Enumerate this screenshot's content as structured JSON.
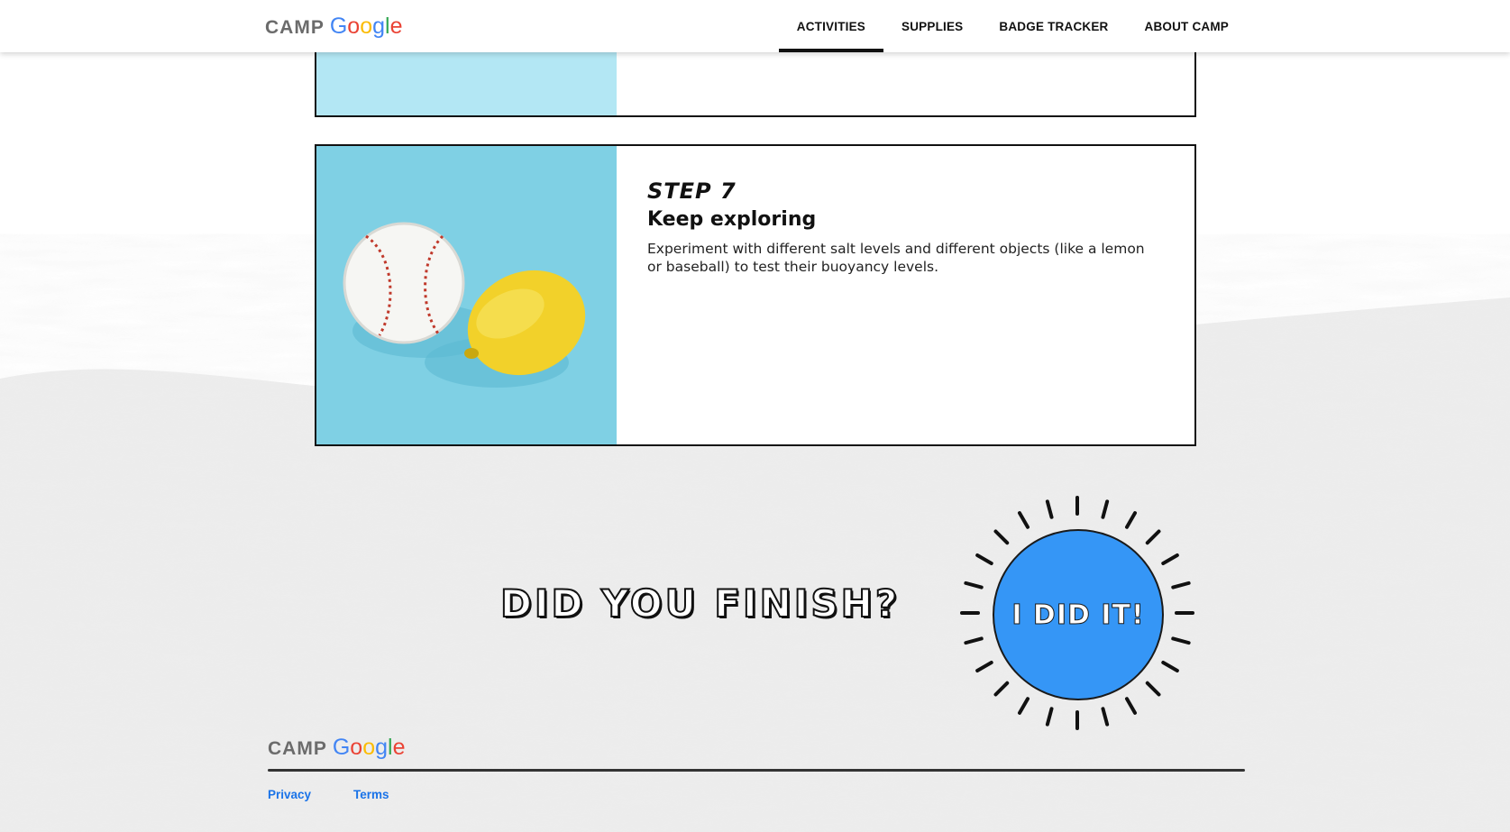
{
  "header": {
    "logo": {
      "camp": "CAMP",
      "google": [
        "G",
        "o",
        "o",
        "g",
        "l",
        "e"
      ]
    },
    "nav": [
      {
        "label": "ACTIVITIES",
        "active": true
      },
      {
        "label": "SUPPLIES",
        "active": false
      },
      {
        "label": "BADGE TRACKER",
        "active": false
      },
      {
        "label": "ABOUT CAMP",
        "active": false
      }
    ]
  },
  "steps": {
    "current": {
      "label": "STEP 7",
      "title": "Keep exploring",
      "text": "Experiment with different salt levels and different objects (like a lemon or baseball) to test their buoyancy levels.",
      "image": "baseball-and-lemon-photo"
    }
  },
  "finish": {
    "question": "DID YOU FINISH?",
    "button_label": "I DID IT!"
  },
  "footer": {
    "logo": {
      "camp": "CAMP",
      "google": [
        "G",
        "o",
        "o",
        "g",
        "l",
        "e"
      ]
    },
    "links": [
      "Privacy",
      "Terms"
    ]
  },
  "colors": {
    "accent_blue": "#3596f6",
    "link_blue": "#1a73e8",
    "photo_bg": "#7fd0e4"
  }
}
